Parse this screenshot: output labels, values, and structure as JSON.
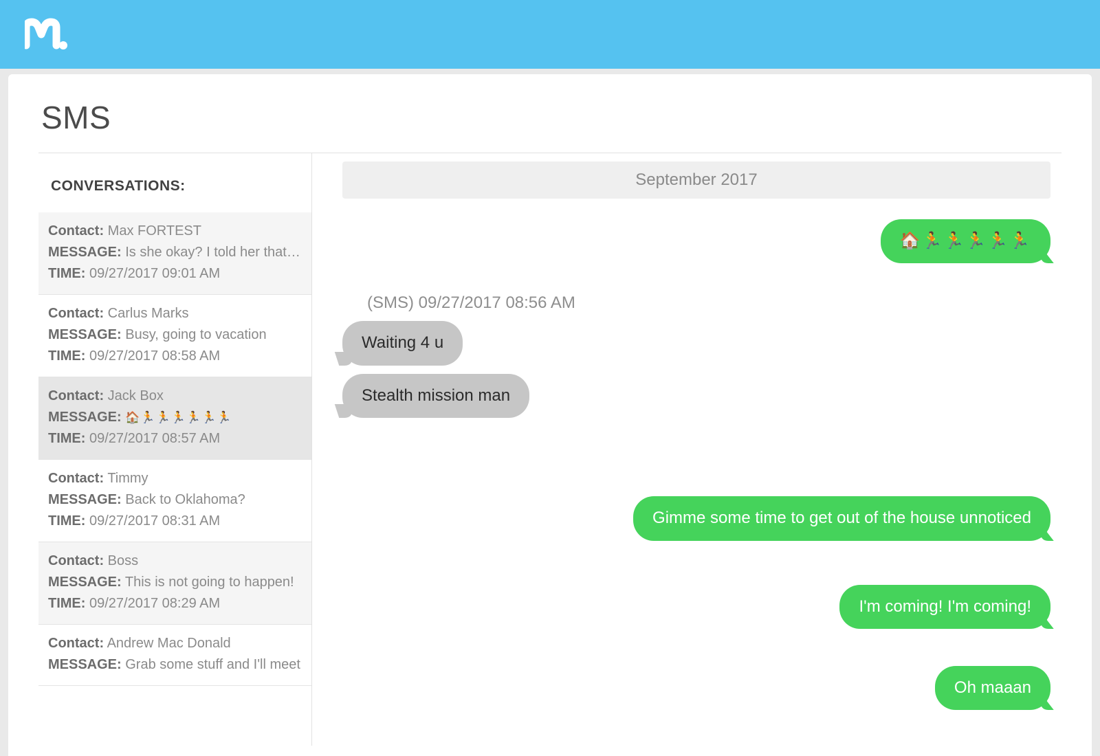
{
  "app": {
    "title": "SMS"
  },
  "labels": {
    "conversations": "CONVERSATIONS:",
    "contact": "Contact:",
    "message": "MESSAGE:",
    "time": "TIME:"
  },
  "sidebar": {
    "items": [
      {
        "contact": "Max FORTEST",
        "message": "Is she okay? I told her that t...",
        "time": "09/27/2017 09:01 AM",
        "selected": false,
        "alt": true
      },
      {
        "contact": "Carlus Marks",
        "message": "Busy, going to vacation",
        "time": "09/27/2017 08:58 AM",
        "selected": false,
        "alt": false
      },
      {
        "contact": "Jack Box",
        "message": "🏠🏃🏃🏃🏃🏃🏃",
        "time": "09/27/2017 08:57 AM",
        "selected": true,
        "alt": false,
        "emoji": true
      },
      {
        "contact": "Timmy",
        "message": "Back to Oklahoma?",
        "time": "09/27/2017 08:31 AM",
        "selected": false,
        "alt": false
      },
      {
        "contact": "Boss",
        "message": "This is not going to happen!",
        "time": "09/27/2017 08:29 AM",
        "selected": false,
        "alt": true
      },
      {
        "contact": "Andrew Mac Donald",
        "message": "Grab some stuff and I'll meet",
        "time": "",
        "selected": false,
        "alt": false
      }
    ]
  },
  "chat": {
    "date_header": "September 2017",
    "messages": [
      {
        "dir": "sent",
        "text": "🏠🏃🏃🏃🏃🏃",
        "emoji": true
      },
      {
        "timestamp": "(SMS) 09/27/2017 08:56 AM"
      },
      {
        "dir": "recv",
        "text": "Waiting 4 u"
      },
      {
        "dir": "recv",
        "text": "Stealth mission man"
      },
      {
        "spacer": 90
      },
      {
        "dir": "sent",
        "text": "Gimme some time to get out of the house unnoticed"
      },
      {
        "spacer": 40
      },
      {
        "dir": "sent",
        "text": "I'm coming! I'm coming!"
      },
      {
        "spacer": 30
      },
      {
        "dir": "sent",
        "text": "Oh maaan"
      }
    ]
  }
}
